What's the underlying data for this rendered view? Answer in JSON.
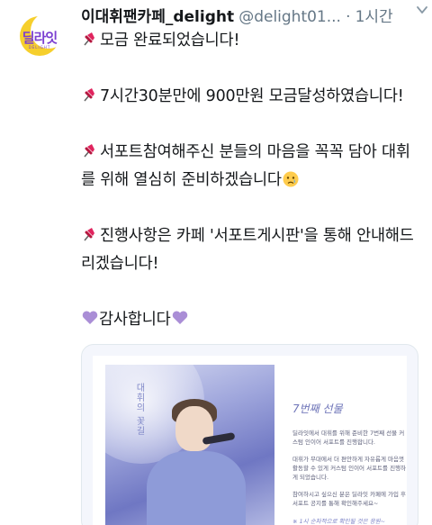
{
  "account": {
    "display_name": "이대휘팬카페_delight",
    "handle": "@delight01...",
    "separator": "·",
    "time": "1시간",
    "avatar": {
      "logo_text": "딜라잇",
      "logo_sub": "DELIGHT",
      "moon_color": "#f6cf2c",
      "text_color": "#7b3fd1"
    }
  },
  "tweet": {
    "lines": [
      {
        "icon": "pin",
        "text": "모금 완료되었습니다!"
      },
      {
        "icon": "pin",
        "text": "7시간30분만에 900만원 모금달성하였습니다!"
      },
      {
        "icon": "pin",
        "text": "서포트참여해주신 분들의 마음을 꼭꼭 담아 대휘를 위해 열심히 준비하겠습니다",
        "suffix_icon": "crying-face"
      },
      {
        "icon": "pin",
        "text": "진행사항은 카페 '서포트게시판'을 통해 안내해드리겠습니다!"
      },
      {
        "icon": "purple-heart",
        "text": "감사합니다",
        "suffix_icon": "purple-heart"
      }
    ]
  },
  "media": {
    "vertical_caption": "대휘의 꽃길",
    "card_title": "7번째 선물",
    "paragraphs": [
      "딜라잇에서 대휘를 위해 준비한 7번째 선물 커스텀 인이어 서포트를 진행합니다.",
      "대휘가 무대에서 더 편안하게 자유롭게 마음껏 활동할 수 있게 커스텀 인이어 서포트를 진행하게 되었습니다.",
      "참여하시고 싶으신 분은 딜라잇 카페에 가입 후 서포트 공지를 통해 확인해주세요~"
    ],
    "footnote": "※ 1시 순차적으로 확인될 것은 응원~"
  }
}
